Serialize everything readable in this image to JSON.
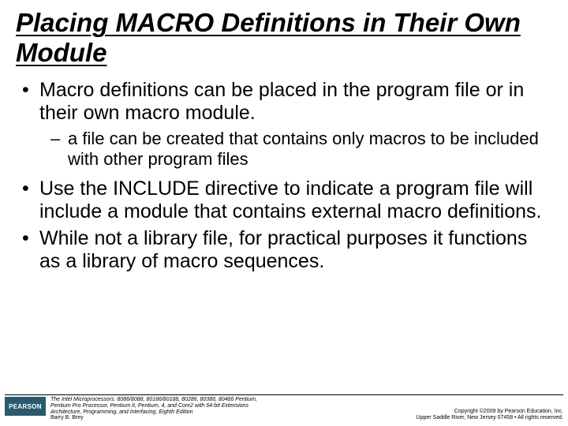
{
  "title": "Placing MACRO Definitions in Their Own Module",
  "bullets": {
    "b1": "Macro definitions can be placed in the program file or in their own macro module.",
    "b1a": "a file can be created that contains only macros to be included with other program files",
    "b2": "Use the INCLUDE directive to indicate a program file will include a module that contains external macro definitions.",
    "b3": "While not a library file, for practical purposes it functions as a library of macro sequences."
  },
  "footer": {
    "logo": "PEARSON",
    "book_line1": "The Intel Microprocessors: 8086/8088, 80186/80188, 80286, 80386, 80486 Pentium,",
    "book_line2": "Pentium Pro Processor, Pentium II, Pentium, 4, and Core2 with 64-bit Extensions",
    "book_line3": "Architecture, Programming, and Interfacing, Eighth Edition",
    "author": "Barry B. Brey",
    "copyright_line1": "Copyright ©2009 by Pearson Education, Inc.",
    "copyright_line2": "Upper Saddle River, New Jersey 07458 • All rights reserved."
  }
}
